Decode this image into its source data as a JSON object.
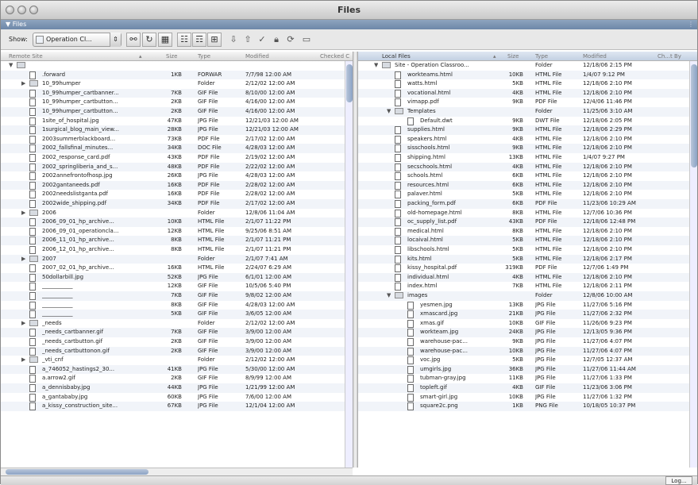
{
  "window": {
    "title": "Files",
    "panel_label": "▼ Files"
  },
  "toolbar": {
    "show_label": "Show:",
    "site_name": "Operation Cl...",
    "checkbox_label": ""
  },
  "left_panel": {
    "headers": {
      "name": "Remote Site",
      "size": "Size",
      "type": "Type",
      "modified": "Modified",
      "checked": "Checked C"
    },
    "rows": [
      {
        "indent": 0,
        "kind": "folder",
        "open": true,
        "name": "",
        "size": "",
        "type": "",
        "modified": ""
      },
      {
        "indent": 1,
        "kind": "doc",
        "name": ".forward",
        "size": "1KB",
        "type": "FORWAR",
        "modified": "7/7/98 12:00 AM"
      },
      {
        "indent": 1,
        "kind": "folder",
        "open": false,
        "name": "10_99humper",
        "size": "",
        "type": "Folder",
        "modified": "2/12/02 12:00 AM"
      },
      {
        "indent": 1,
        "kind": "doc",
        "name": "10_99humper_cartbanner...",
        "size": "7KB",
        "type": "GIF File",
        "modified": "8/10/00 12:00 AM"
      },
      {
        "indent": 1,
        "kind": "doc",
        "name": "10_99humper_cartbutton...",
        "size": "2KB",
        "type": "GIF File",
        "modified": "4/16/00 12:00 AM"
      },
      {
        "indent": 1,
        "kind": "doc",
        "name": "10_99humper_cartbutton...",
        "size": "2KB",
        "type": "GIF File",
        "modified": "4/16/00 12:00 AM"
      },
      {
        "indent": 1,
        "kind": "doc",
        "name": "1site_of_hospital.jpg",
        "size": "47KB",
        "type": "JPG File",
        "modified": "12/21/03 12:00 AM"
      },
      {
        "indent": 1,
        "kind": "doc",
        "name": "1surgical_blog_main_view...",
        "size": "28KB",
        "type": "JPG File",
        "modified": "12/21/03 12:00 AM"
      },
      {
        "indent": 1,
        "kind": "doc",
        "name": "2003summerblackboard...",
        "size": "73KB",
        "type": "PDF File",
        "modified": "2/17/02 12:00 AM"
      },
      {
        "indent": 1,
        "kind": "doc",
        "name": "2002_fallsfinal_minutes...",
        "size": "34KB",
        "type": "DOC File",
        "modified": "4/28/03 12:00 AM"
      },
      {
        "indent": 1,
        "kind": "doc",
        "name": "2002_response_card.pdf",
        "size": "43KB",
        "type": "PDF File",
        "modified": "2/19/02 12:00 AM"
      },
      {
        "indent": 1,
        "kind": "doc",
        "name": "2002_springliberia_and_s...",
        "size": "48KB",
        "type": "PDF File",
        "modified": "2/22/02 12:00 AM"
      },
      {
        "indent": 1,
        "kind": "doc",
        "name": "2002annefrontofhosp.jpg",
        "size": "26KB",
        "type": "JPG File",
        "modified": "4/28/03 12:00 AM"
      },
      {
        "indent": 1,
        "kind": "doc",
        "name": "2002gantaneeds.pdf",
        "size": "16KB",
        "type": "PDF File",
        "modified": "2/28/02 12:00 AM"
      },
      {
        "indent": 1,
        "kind": "doc",
        "name": "2002needslistganta.pdf",
        "size": "16KB",
        "type": "PDF File",
        "modified": "2/28/02 12:00 AM"
      },
      {
        "indent": 1,
        "kind": "doc",
        "name": "2002wide_shipping.pdf",
        "size": "34KB",
        "type": "PDF File",
        "modified": "2/17/02 12:00 AM"
      },
      {
        "indent": 1,
        "kind": "folder",
        "open": false,
        "name": "2006",
        "size": "",
        "type": "Folder",
        "modified": "12/8/06 11:04 AM"
      },
      {
        "indent": 1,
        "kind": "doc",
        "name": "2006_09_01_hp_archive...",
        "size": "10KB",
        "type": "HTML File",
        "modified": "2/1/07 11:22 PM"
      },
      {
        "indent": 1,
        "kind": "doc",
        "name": "2006_09_01_operationcla...",
        "size": "12KB",
        "type": "HTML File",
        "modified": "9/25/06 8:51 AM"
      },
      {
        "indent": 1,
        "kind": "doc",
        "name": "2006_11_01_hp_archive...",
        "size": "8KB",
        "type": "HTML File",
        "modified": "2/1/07 11:21 PM"
      },
      {
        "indent": 1,
        "kind": "doc",
        "name": "2006_12_01_hp_archive...",
        "size": "8KB",
        "type": "HTML File",
        "modified": "2/1/07 11:21 PM"
      },
      {
        "indent": 1,
        "kind": "folder",
        "open": false,
        "name": "2007",
        "size": "",
        "type": "Folder",
        "modified": "2/1/07 7:41 AM"
      },
      {
        "indent": 1,
        "kind": "doc",
        "name": "2007_02_01_hp_archive...",
        "size": "16KB",
        "type": "HTML File",
        "modified": "2/24/07 6:29 AM"
      },
      {
        "indent": 1,
        "kind": "doc",
        "name": "50dollarbill.jpg",
        "size": "52KB",
        "type": "JPG File",
        "modified": "6/1/01 12:00 AM"
      },
      {
        "indent": 1,
        "kind": "doc",
        "name": "___________",
        "size": "12KB",
        "type": "GIF File",
        "modified": "10/5/06 5:40 PM"
      },
      {
        "indent": 1,
        "kind": "doc",
        "name": "___________",
        "size": "7KB",
        "type": "GIF File",
        "modified": "9/8/02 12:00 AM"
      },
      {
        "indent": 1,
        "kind": "doc",
        "name": "___________",
        "size": "8KB",
        "type": "GIF File",
        "modified": "4/28/03 12:00 AM"
      },
      {
        "indent": 1,
        "kind": "doc",
        "name": "___________",
        "size": "5KB",
        "type": "GIF File",
        "modified": "3/6/05 12:00 AM"
      },
      {
        "indent": 1,
        "kind": "folder",
        "open": false,
        "name": "_needs",
        "size": "",
        "type": "Folder",
        "modified": "2/12/02 12:00 AM"
      },
      {
        "indent": 1,
        "kind": "doc",
        "name": "_needs_cartbanner.gif",
        "size": "7KB",
        "type": "GIF File",
        "modified": "3/9/00 12:00 AM"
      },
      {
        "indent": 1,
        "kind": "doc",
        "name": "_needs_cartbutton.gif",
        "size": "2KB",
        "type": "GIF File",
        "modified": "3/9/00 12:00 AM"
      },
      {
        "indent": 1,
        "kind": "doc",
        "name": "_needs_cartbuttonon.gif",
        "size": "2KB",
        "type": "GIF File",
        "modified": "3/9/00 12:00 AM"
      },
      {
        "indent": 1,
        "kind": "folder",
        "open": false,
        "name": "_vti_cnf",
        "size": "",
        "type": "Folder",
        "modified": "2/12/02 12:00 AM"
      },
      {
        "indent": 1,
        "kind": "doc",
        "name": "a_746052_hastings2_30...",
        "size": "41KB",
        "type": "JPG File",
        "modified": "5/30/00 12:00 AM"
      },
      {
        "indent": 1,
        "kind": "doc",
        "name": "a.arrow2.gif",
        "size": "2KB",
        "type": "GIF File",
        "modified": "8/9/99 12:00 AM"
      },
      {
        "indent": 1,
        "kind": "doc",
        "name": "a_dennisbaby.jpg",
        "size": "44KB",
        "type": "JPG File",
        "modified": "1/21/99 12:00 AM"
      },
      {
        "indent": 1,
        "kind": "doc",
        "name": "a_gantababy.jpg",
        "size": "60KB",
        "type": "JPG File",
        "modified": "7/6/00 12:00 AM"
      },
      {
        "indent": 1,
        "kind": "doc",
        "name": "a_kissy_construction_site...",
        "size": "67KB",
        "type": "JPG File",
        "modified": "12/1/04 12:00 AM"
      }
    ]
  },
  "right_panel": {
    "headers": {
      "name": "Local Files",
      "size": "Size",
      "type": "Type",
      "modified": "Modified",
      "checked": "Ch...t By"
    },
    "rows": [
      {
        "indent": 0,
        "kind": "folder",
        "open": true,
        "name": "Site - Operation Classroo...",
        "size": "",
        "type": "Folder",
        "modified": "12/18/06 2:15 PM"
      },
      {
        "indent": 1,
        "kind": "doc",
        "name": "workteams.html",
        "size": "10KB",
        "type": "HTML File",
        "modified": "1/4/07 9:12 PM"
      },
      {
        "indent": 1,
        "kind": "doc",
        "name": "watts.html",
        "size": "5KB",
        "type": "HTML File",
        "modified": "12/18/06 2:10 PM"
      },
      {
        "indent": 1,
        "kind": "doc",
        "name": "vocational.html",
        "size": "4KB",
        "type": "HTML File",
        "modified": "12/18/06 2:10 PM"
      },
      {
        "indent": 1,
        "kind": "doc",
        "name": "vimapp.pdf",
        "size": "9KB",
        "type": "PDF File",
        "modified": "12/4/06 11:46 PM"
      },
      {
        "indent": 1,
        "kind": "folder",
        "open": true,
        "name": "Templates",
        "size": "",
        "type": "Folder",
        "modified": "11/25/06 3:10 AM"
      },
      {
        "indent": 2,
        "kind": "doc",
        "name": "Default.dwt",
        "size": "9KB",
        "type": "DWT File",
        "modified": "12/18/06 2:05 PM"
      },
      {
        "indent": 1,
        "kind": "doc",
        "name": "supplies.html",
        "size": "9KB",
        "type": "HTML File",
        "modified": "12/18/06 2:29 PM"
      },
      {
        "indent": 1,
        "kind": "doc",
        "name": "speakers.html",
        "size": "4KB",
        "type": "HTML File",
        "modified": "12/18/06 2:10 PM"
      },
      {
        "indent": 1,
        "kind": "doc",
        "name": "sisschools.html",
        "size": "9KB",
        "type": "HTML File",
        "modified": "12/18/06 2:10 PM"
      },
      {
        "indent": 1,
        "kind": "doc",
        "name": "shipping.html",
        "size": "13KB",
        "type": "HTML File",
        "modified": "1/4/07 9:27 PM"
      },
      {
        "indent": 1,
        "kind": "doc",
        "name": "secschools.html",
        "size": "4KB",
        "type": "HTML File",
        "modified": "12/18/06 2:10 PM"
      },
      {
        "indent": 1,
        "kind": "doc",
        "name": "schools.html",
        "size": "6KB",
        "type": "HTML File",
        "modified": "12/18/06 2:10 PM"
      },
      {
        "indent": 1,
        "kind": "doc",
        "name": "resources.html",
        "size": "6KB",
        "type": "HTML File",
        "modified": "12/18/06 2:10 PM"
      },
      {
        "indent": 1,
        "kind": "doc",
        "name": "palaver.html",
        "size": "5KB",
        "type": "HTML File",
        "modified": "12/18/06 2:10 PM"
      },
      {
        "indent": 1,
        "kind": "doc",
        "name": "packing_form.pdf",
        "size": "6KB",
        "type": "PDF File",
        "modified": "11/23/06 10:29 AM"
      },
      {
        "indent": 1,
        "kind": "doc",
        "name": "old-homepage.html",
        "size": "8KB",
        "type": "HTML File",
        "modified": "12/7/06 10:36 PM"
      },
      {
        "indent": 1,
        "kind": "doc",
        "name": "oc_supply_list.pdf",
        "size": "43KB",
        "type": "PDF File",
        "modified": "12/18/06 12:48 PM"
      },
      {
        "indent": 1,
        "kind": "doc",
        "name": "medical.html",
        "size": "8KB",
        "type": "HTML File",
        "modified": "12/18/06 2:10 PM"
      },
      {
        "indent": 1,
        "kind": "doc",
        "name": "locaival.html",
        "size": "5KB",
        "type": "HTML File",
        "modified": "12/18/06 2:10 PM"
      },
      {
        "indent": 1,
        "kind": "doc",
        "name": "libschools.html",
        "size": "5KB",
        "type": "HTML File",
        "modified": "12/18/06 2:10 PM"
      },
      {
        "indent": 1,
        "kind": "doc",
        "name": "kits.html",
        "size": "5KB",
        "type": "HTML File",
        "modified": "12/18/06 2:17 PM"
      },
      {
        "indent": 1,
        "kind": "doc",
        "name": "kissy_hospital.pdf",
        "size": "319KB",
        "type": "PDF File",
        "modified": "12/7/06 1:49 PM"
      },
      {
        "indent": 1,
        "kind": "doc",
        "name": "individual.html",
        "size": "4KB",
        "type": "HTML File",
        "modified": "12/18/06 2:10 PM"
      },
      {
        "indent": 1,
        "kind": "doc",
        "name": "index.html",
        "size": "7KB",
        "type": "HTML File",
        "modified": "12/18/06 2:11 PM"
      },
      {
        "indent": 1,
        "kind": "folder",
        "open": true,
        "name": "images",
        "size": "",
        "type": "Folder",
        "modified": "12/8/06 10:00 AM"
      },
      {
        "indent": 2,
        "kind": "doc",
        "name": "yesmen.jpg",
        "size": "13KB",
        "type": "JPG File",
        "modified": "11/27/06 5:16 PM"
      },
      {
        "indent": 2,
        "kind": "doc",
        "name": "xmascard.jpg",
        "size": "21KB",
        "type": "JPG File",
        "modified": "11/27/06 2:32 PM"
      },
      {
        "indent": 2,
        "kind": "doc",
        "name": "xmas.gif",
        "size": "10KB",
        "type": "GIF File",
        "modified": "11/26/06 9:23 PM"
      },
      {
        "indent": 2,
        "kind": "doc",
        "name": "workteam.jpg",
        "size": "24KB",
        "type": "JPG File",
        "modified": "12/13/05 9:36 PM"
      },
      {
        "indent": 2,
        "kind": "doc",
        "name": "warehouse-pac...",
        "size": "9KB",
        "type": "JPG File",
        "modified": "11/27/06 4:07 PM"
      },
      {
        "indent": 2,
        "kind": "doc",
        "name": "warehouse-pac...",
        "size": "10KB",
        "type": "JPG File",
        "modified": "11/27/06 4:07 PM"
      },
      {
        "indent": 2,
        "kind": "doc",
        "name": "voc.jpg",
        "size": "5KB",
        "type": "JPG File",
        "modified": "12/7/05 12:37 AM"
      },
      {
        "indent": 2,
        "kind": "doc",
        "name": "umgirls.jpg",
        "size": "36KB",
        "type": "JPG File",
        "modified": "11/27/06 11:44 AM"
      },
      {
        "indent": 2,
        "kind": "doc",
        "name": "tubman-gray.jpg",
        "size": "11KB",
        "type": "JPG File",
        "modified": "11/27/06 1:33 PM"
      },
      {
        "indent": 2,
        "kind": "doc",
        "name": "topleft.gif",
        "size": "4KB",
        "type": "GIF File",
        "modified": "11/23/06 3:06 PM"
      },
      {
        "indent": 2,
        "kind": "doc",
        "name": "smart-girl.jpg",
        "size": "10KB",
        "type": "JPG File",
        "modified": "11/27/06 1:32 PM"
      },
      {
        "indent": 2,
        "kind": "doc",
        "name": "square2c.png",
        "size": "1KB",
        "type": "PNG File",
        "modified": "10/18/05 10:37 PM"
      }
    ]
  },
  "status": {
    "log_label": "Log..."
  }
}
